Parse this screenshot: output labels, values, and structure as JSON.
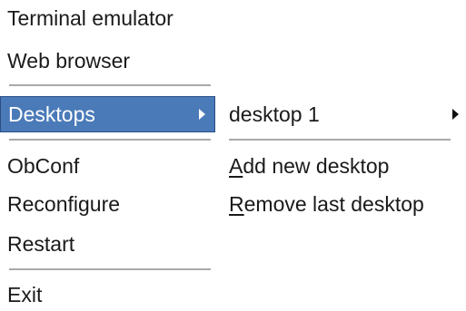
{
  "main_menu": {
    "items": [
      {
        "label": "Terminal emulator"
      },
      {
        "label": "Web browser"
      },
      {
        "label": "Desktops",
        "active": true,
        "has_submenu": true
      },
      {
        "label": "ObConf"
      },
      {
        "label": "Reconfigure"
      },
      {
        "label": "Restart"
      },
      {
        "label": "Exit"
      }
    ]
  },
  "submenu": {
    "items": [
      {
        "label": "desktop 1",
        "has_submenu": true
      },
      {
        "accel": "A",
        "rest": "dd new desktop"
      },
      {
        "accel": "R",
        "rest": "emove last desktop"
      }
    ]
  },
  "colors": {
    "highlight": "#4a7ab8",
    "highlight_border": "#2b4f86",
    "text": "#1a1a1a",
    "separator": "#9a9a9a"
  }
}
